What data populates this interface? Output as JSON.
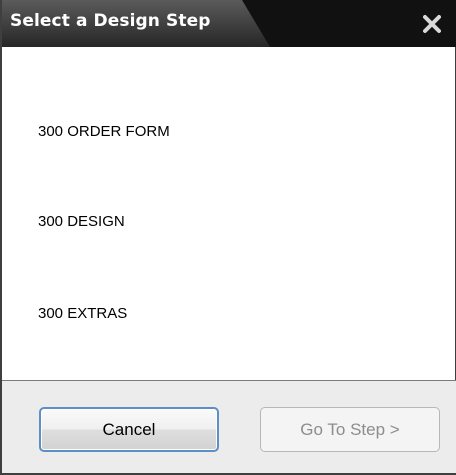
{
  "dialog": {
    "title": "Select a Design Step",
    "close_icon": "close-x-icon"
  },
  "steps": [
    {
      "label": "300 ORDER FORM"
    },
    {
      "label": "300 DESIGN"
    },
    {
      "label": "300 EXTRAS"
    }
  ],
  "buttons": {
    "cancel_label": "Cancel",
    "goto_label": "Go To Step >",
    "goto_enabled": false
  },
  "colors": {
    "titlebar": "#111111",
    "title_tab": "#3e3e3e",
    "focus_border": "#5b8fc6",
    "footer_bg": "#ececec",
    "disabled_text": "#8d8d8d"
  }
}
